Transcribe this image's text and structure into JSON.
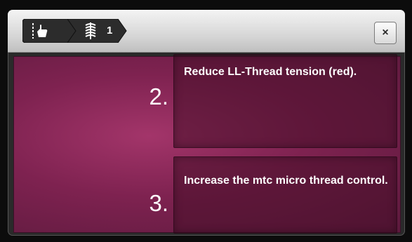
{
  "header": {
    "breadcrumb": [
      {
        "icon": "hand-pointer-icon"
      },
      {
        "icon": "thread-coil-icon",
        "count": "1"
      }
    ],
    "close_label": "×"
  },
  "steps": [
    {
      "number": "2.",
      "text": "Reduce LL-Thread tension (red)."
    },
    {
      "number": "3.",
      "text": "Increase the mtc micro thread control."
    }
  ],
  "colors": {
    "content_bg": "#8a2656",
    "header_bg": "#d6d6d6",
    "crumb_bg": "#2c2c2c"
  }
}
